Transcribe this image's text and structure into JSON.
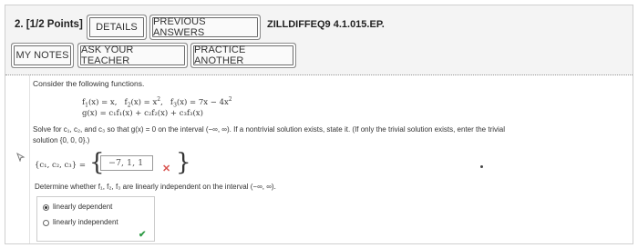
{
  "question": {
    "number": "2.",
    "points": "[1/2 Points]",
    "code": "ZILLDIFFEQ9 4.1.015.EP."
  },
  "toolbar": {
    "details": "DETAILS",
    "previous_answers": "PREVIOUS ANSWERS",
    "my_notes": "MY NOTES",
    "ask_teacher": "ASK YOUR TEACHER",
    "practice_another": "PRACTICE ANOTHER"
  },
  "problem": {
    "intro": "Consider the following functions.",
    "f1_label": "f",
    "f1_sub": "1",
    "f1_expr": "(x) = x,",
    "f2_label": "f",
    "f2_sub": "2",
    "f2_expr": "(x) = x",
    "f2_sup": "2",
    "f3_label": "f",
    "f3_sub": "3",
    "f3_expr": "(x) = 7x − 4x",
    "f3_sup": "2",
    "g_expr": "g(x) = c₁f₁(x) + c₂f₂(x) + c₃f₃(x)",
    "solve_line1": "Solve for c₁, c₂, and c₃ so that g(x) = 0 on the interval (−∞, ∞). If a nontrivial solution exists, state it. (If only the trivial solution exists, enter the trivial",
    "solve_line2": "solution {0, 0, 0}.)",
    "tuple_label": "{c₁, c₂, c₃} =",
    "answer_value": "−7, 1, 1",
    "independence_prompt": "Determine whether f₁, f₂, f₃ are linearly independent on the interval (−∞, ∞).",
    "option_dependent": "linearly dependent",
    "option_independent": "linearly independent",
    "selected_option": "linearly dependent"
  },
  "icons": {
    "incorrect": "x-icon",
    "correct": "check-icon",
    "cursor": "cursor-icon"
  },
  "colors": {
    "incorrect": "#d9534f",
    "correct": "#2e9b45"
  }
}
